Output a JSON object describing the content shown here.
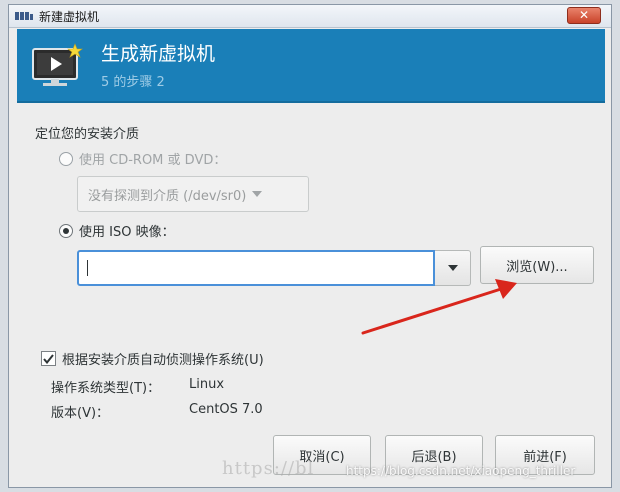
{
  "window": {
    "title": "新建虚拟机",
    "close_label": "✕",
    "colors": {
      "header_bg": "#1a7fb8",
      "focus": "#4a90d9",
      "arrow": "#d9261c"
    }
  },
  "header": {
    "title": "生成新虚拟机",
    "step": "5 的步骤 2",
    "icon": "monitor-play-icon"
  },
  "media": {
    "section_label": "定位您的安装介质",
    "cdrom_label": "使用 CD-ROM 或 DVD：",
    "cdrom_select_value": "没有探测到介质 (/dev/sr0)",
    "iso_label": "使用 ISO 映像：",
    "iso_value": "",
    "browse_label": "浏览(W)...",
    "cdrom_selected": false,
    "iso_selected": true
  },
  "detect": {
    "checkbox_label": "根据安装介质自动侦测操作系统(U)",
    "checked": true,
    "os_type_label": "操作系统类型(T)：",
    "os_type_value": "Linux",
    "version_label": "版本(V)：",
    "version_value": "CentOS 7.0"
  },
  "footer": {
    "cancel_label": "取消(C)",
    "back_label": "后退(B)",
    "forward_label": "前进(F)"
  },
  "watermark": {
    "faint_text": "https://bl",
    "url_text": "https://blog.csdn.net/xiaopeng_thriller"
  }
}
